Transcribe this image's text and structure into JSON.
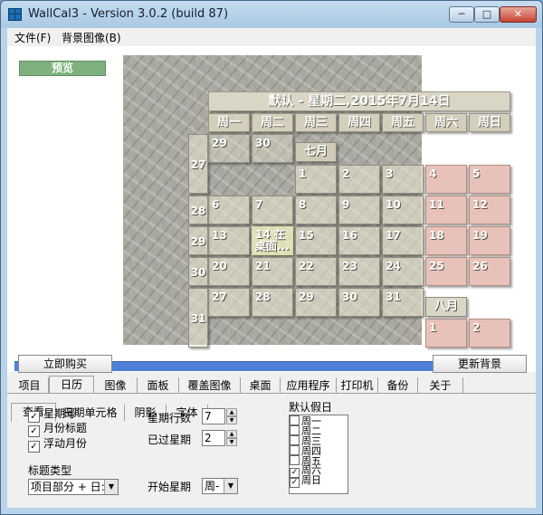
{
  "window": {
    "title": "WallCal3 - Version 3.0.2 (build 87)",
    "min": "─",
    "max": "□",
    "close": "✕"
  },
  "menu": [
    "文件(F)",
    "背景图像(B)"
  ],
  "preview": {
    "label": "预览",
    "calendar_title": "默认 - 星期二,2015年7月14日",
    "day_headers": [
      "周一",
      "周二",
      "周三",
      "周四",
      "周五",
      "周六",
      "周日"
    ],
    "weeks": [
      "27",
      "28",
      "29",
      "30",
      "31"
    ],
    "july_label": "七月",
    "august_label": "八月",
    "days": [
      "29",
      "30",
      "1",
      "2",
      "3",
      "4",
      "5",
      "6",
      "7",
      "8",
      "9",
      "10",
      "11",
      "12",
      "13",
      "14 在桌面...",
      "15",
      "16",
      "17",
      "18",
      "19",
      "20",
      "21",
      "22",
      "23",
      "24",
      "25",
      "26",
      "27",
      "28",
      "29",
      "30",
      "31",
      "1",
      "2"
    ],
    "buy_button": "立即购买",
    "update_button": "更新背景"
  },
  "tabs": [
    "项目",
    "日历",
    "图像",
    "面板",
    "覆盖图像",
    "桌面",
    "应用程序",
    "打印机",
    "备份",
    "关于"
  ],
  "subtabs": [
    "查看",
    "日期单元格",
    "阴影",
    "字体"
  ],
  "view": {
    "checkboxes": [
      {
        "label": "星期号",
        "checked": true
      },
      {
        "label": "月份标题",
        "checked": true
      },
      {
        "label": "浮动月份",
        "checked": true
      }
    ],
    "title_type_label": "标题类型",
    "title_type_value": "项目部分 + 日:",
    "week_rows_label": "星期行数",
    "week_rows_value": "7",
    "past_weeks_label": "已过星期",
    "past_weeks_value": "2",
    "start_day_label": "开始星期",
    "start_day_value": "周-",
    "holidays_label": "默认假日",
    "holidays": [
      {
        "label": "周一",
        "checked": false
      },
      {
        "label": "周二",
        "checked": false
      },
      {
        "label": "周三",
        "checked": false
      },
      {
        "label": "周四",
        "checked": false
      },
      {
        "label": "周五",
        "checked": false
      },
      {
        "label": "周六",
        "checked": true
      },
      {
        "label": "周日",
        "checked": true
      }
    ]
  },
  "colors": {
    "weekend_cell": "#e8c2b8",
    "taskbar": "#4f7fd6",
    "preview_label": "#7fb07f"
  }
}
